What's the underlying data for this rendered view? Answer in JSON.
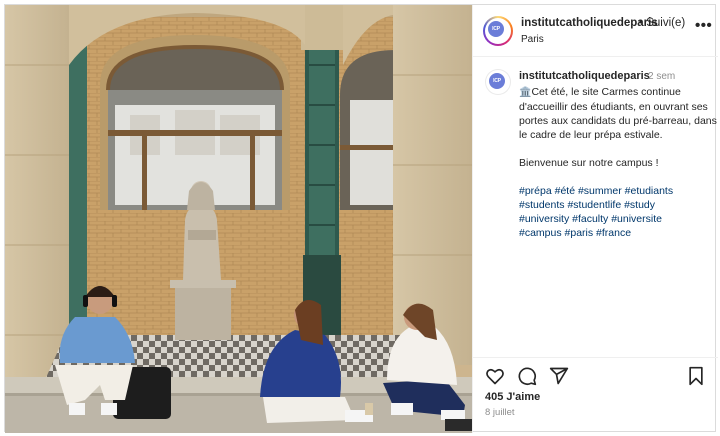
{
  "header": {
    "username": "institutcatholiquedeparis",
    "follow_status": "• Suivi(e)",
    "location": "Paris",
    "more_label": "•••",
    "avatar_text": "ICP"
  },
  "post": {
    "username": "institutcatholiquedeparis",
    "time_ago": "2 sem",
    "caption_lines": [
      "Cet été, le site Carmes continue d'accueillir des étudiants, en ouvrant ses portes aux candidats du pré-barreau, dans le cadre de leur prépa estivale."
    ],
    "caption_welcome": "Bienvenue sur notre campus !",
    "hashtags_1": "#prépa #été #summer #etudiants",
    "hashtags_2": "#students #studentlife #study",
    "hashtags_3": "#university #faculty #universite",
    "hashtags_4": "#campus #paris #france",
    "emoji": "🏛️"
  },
  "stats": {
    "likes": "405 J'aime",
    "date": "8 juillet"
  },
  "icons": {
    "like": "heart-icon",
    "comment": "comment-icon",
    "share": "send-icon",
    "save": "bookmark-icon"
  },
  "colors": {
    "hashtag": "#00376b",
    "muted": "#8e8e8e",
    "text": "#262626"
  }
}
